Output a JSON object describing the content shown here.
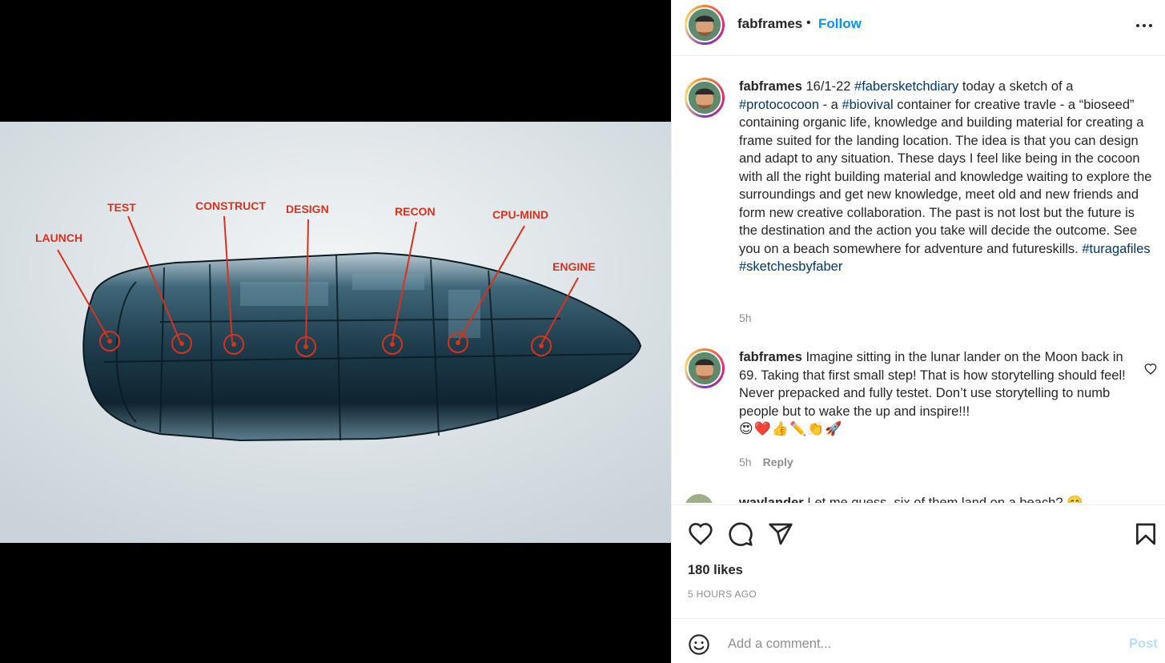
{
  "media": {
    "labels": [
      "LAUNCH",
      "TEST",
      "CONSTRUCT",
      "DESIGN",
      "RECON",
      "CPU-MIND",
      "ENGINE"
    ]
  },
  "header": {
    "username": "fabframes",
    "separator": "•",
    "follow_label": "Follow",
    "more_icon": "more-horizontal-icon"
  },
  "caption": {
    "username": "fabframes",
    "date": "16/1-22",
    "tag1": "#fabersketchdiary",
    "t1": "today a sketch of a",
    "tag2": "#protococoon",
    "t2": "- a",
    "tag3": "#biovival",
    "t3": "container for creative travle - a “bioseed” containing organic life, knowledge and building material for creating a frame suited for the landing location. The idea is that you can design and adapt to any situation. These days I feel like being in the cocoon with all the right building material and knowledge waiting to explore the surroundings and get new knowledge, meet old and new friends and form new creative collaboration. The past is not lost but the future is the destination and the action you take will decide the outcome. See you on a beach somewhere for adventure and futureskills.",
    "tag4": "#turagafiles",
    "tag5": "#sketchesbyfaber",
    "age": "5h"
  },
  "comments": [
    {
      "username": "fabframes",
      "text": "Imagine sitting in the lunar lander on the Moon back in 69. Taking that first small step! That is how storytelling should feel! Never prepacked and fully testet. Don’t use storytelling to numb people but to wake the up and inspire!!!",
      "emojis": "😍❤️👍✏️👏🚀",
      "age": "5h",
      "reply_label": "Reply"
    },
    {
      "username": "waylander",
      "text": "Let me guess, six of them land on a beach? 😊"
    }
  ],
  "actions": {
    "like_icon": "heart-icon",
    "comment_icon": "comment-icon",
    "share_icon": "share-icon",
    "save_icon": "bookmark-icon"
  },
  "likes": "180 likes",
  "timestamp": "5 HOURS AGO",
  "add_comment": {
    "placeholder": "Add a comment...",
    "post_label": "Post"
  },
  "colors": {
    "accent": "#0095f6",
    "post_disabled": "#b2dffc",
    "hashtag": "#00376b",
    "muted": "#8e8e8e"
  }
}
